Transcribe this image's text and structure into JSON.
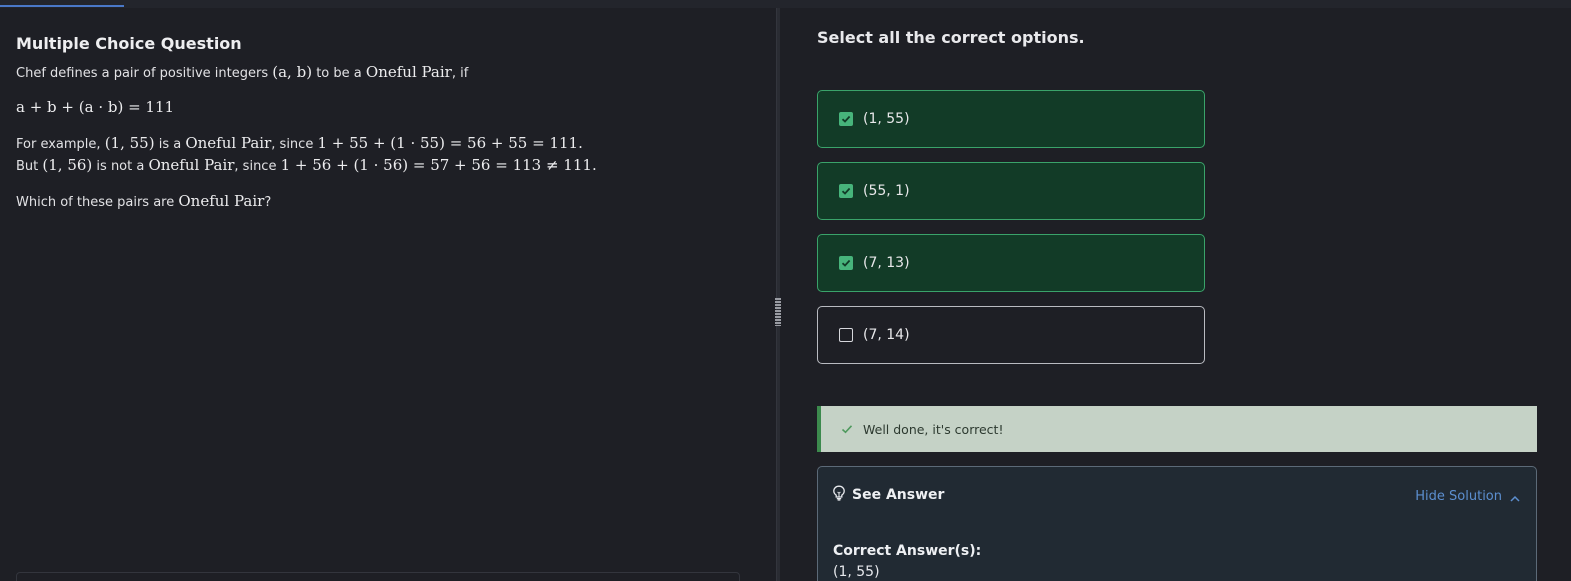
{
  "question": {
    "title": "Multiple Choice Question",
    "intro_prefix": "Chef defines a pair of positive integers",
    "intro_pair": "(a, b)",
    "intro_mid": "to be a",
    "term": "Oneful Pair",
    "intro_suffix": ", if",
    "equation": "a + b + (a · b) = 111",
    "example1_prefix": "For example,",
    "example1_pair": "(1, 55)",
    "example1_mid": "is a",
    "example1_since": ", since",
    "example1_math": "1 + 55 + (1 · 55) = 56 + 55 = 111.",
    "example2_prefix": "But",
    "example2_pair": "(1, 56)",
    "example2_mid": "is not a",
    "example2_since": ", since",
    "example2_math": "1 + 56 + (1 · 56) = 57 + 56 = 113 ≠ 111.",
    "prompt_prefix": "Which of these pairs are",
    "prompt_suffix": "?"
  },
  "answers": {
    "heading": "Select all the correct options.",
    "options": [
      {
        "label": "(1, 55)",
        "checked": true
      },
      {
        "label": "(55, 1)",
        "checked": true
      },
      {
        "label": "(7, 13)",
        "checked": true
      },
      {
        "label": "(7, 14)",
        "checked": false
      }
    ],
    "feedback": "Well done, it's correct!",
    "see_answer": "See Answer",
    "hide_solution": "Hide Solution",
    "correct_heading": "Correct Answer(s):",
    "correct_value": "(1, 55)"
  },
  "colors": {
    "accent": "#4a78c8",
    "checked_bg": "#123b27",
    "checked_border": "#3aa36a",
    "success_banner": "#c5d2c6",
    "link": "#5c8fd0"
  },
  "icons": [
    "checkbox-checked-icon",
    "checkbox-empty-icon",
    "check-icon",
    "lightbulb-icon",
    "chevron-up-icon",
    "drag-handle-icon"
  ]
}
